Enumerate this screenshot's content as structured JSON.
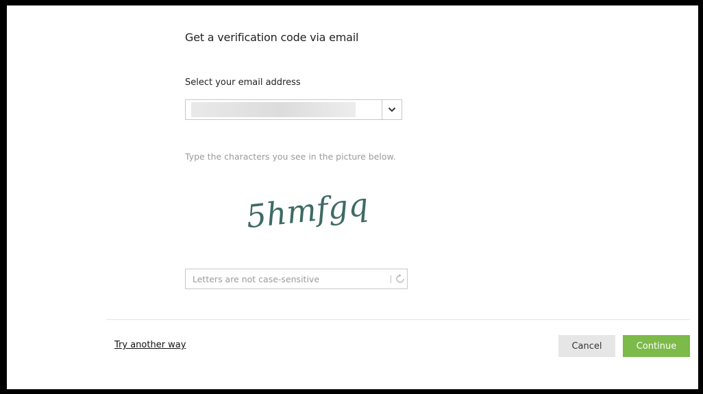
{
  "dialog": {
    "title": "Get a verification code via email",
    "select_label": "Select your email address",
    "email_select": {
      "value": "",
      "redacted": true
    },
    "instructions": "Type the characters you see in the picture below.",
    "captcha_text": "5hmfgq",
    "captcha_input": {
      "value": "",
      "placeholder": "Letters are not case-sensitive"
    },
    "try_another_way": "Try another way",
    "buttons": {
      "cancel": "Cancel",
      "continue": "Continue"
    }
  },
  "icons": {
    "select_arrow": "chevron-down-icon",
    "refresh": "refresh-icon"
  },
  "colors": {
    "continue_button": "#7cba49",
    "cancel_button": "#e6e6e6",
    "captcha_text": "#3e6b64",
    "instructions_text": "#9a9a9a"
  }
}
